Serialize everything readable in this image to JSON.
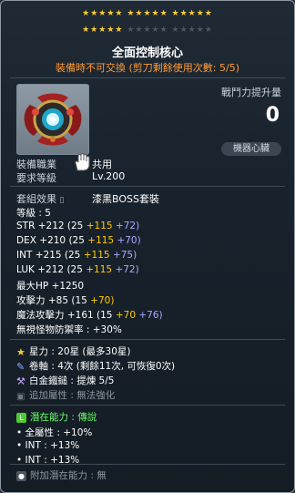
{
  "stars_row1": "★★★★★  ★★★★★  ★★★★★",
  "stars_row2": "★★★★★  ★★★★★  ★★★★★",
  "stars_filled": 20,
  "stars_max": 30,
  "title": "全面控制核心",
  "trade_note": "裝備時不可交換 (剪刀剩餘使用次數: 5/5)",
  "combat_power_label": "戰鬥力提升量",
  "combat_power_value": "0",
  "badge": "機器心臟",
  "job_label": "裝備職業",
  "job_value": "共用",
  "req_level_label": "要求等級",
  "req_level_value": "Lv.200",
  "set_label": "套組效果",
  "set_value": "漆黑BOSS套裝",
  "level_line": "等級 : 5",
  "stats": [
    {
      "name": "STR",
      "total": "+212",
      "base": "(25",
      "star": "+115",
      "flame": "+72)"
    },
    {
      "name": "DEX",
      "total": "+210",
      "base": "(25",
      "star": "+115",
      "flame": "+70)"
    },
    {
      "name": "INT",
      "total": "+215",
      "base": "(25",
      "star": "+115",
      "flame": "+75)"
    },
    {
      "name": "LUK",
      "total": "+212",
      "base": "(25",
      "star": "+115",
      "flame": "+72)"
    }
  ],
  "hp_label": "最大HP",
  "hp_value": "+1250",
  "atk_label": "攻擊力",
  "atk_total": "+85",
  "atk_base": "(15",
  "atk_star": "+70)",
  "matk_label": "魔法攻擊力",
  "matk_total": "+161",
  "matk_base": "(15",
  "matk_star": "+70",
  "matk_flame": "+76)",
  "ignore_def": "無視怪物防禦率 : +30%",
  "star_force": "星力 : 20星 (最多30星)",
  "scroll_info": "卷軸 : 4次 (剩餘11次, 可恢復0次)",
  "golden_hammer": "白金鐵鎚 : 提煉 5/5",
  "additional_attr": "追加屬性 : 無法強化",
  "potential_title": "潛在能力 : 傳說",
  "potential_lines": [
    "全屬性 : +10%",
    "INT : +13%",
    "INT : +13%"
  ],
  "bonus_potential": "附加潛在能力 : 無",
  "colors": {
    "star_gold": "#ffcc33",
    "potential_green": "#4dcc33",
    "trade_orange": "#ff9933"
  }
}
